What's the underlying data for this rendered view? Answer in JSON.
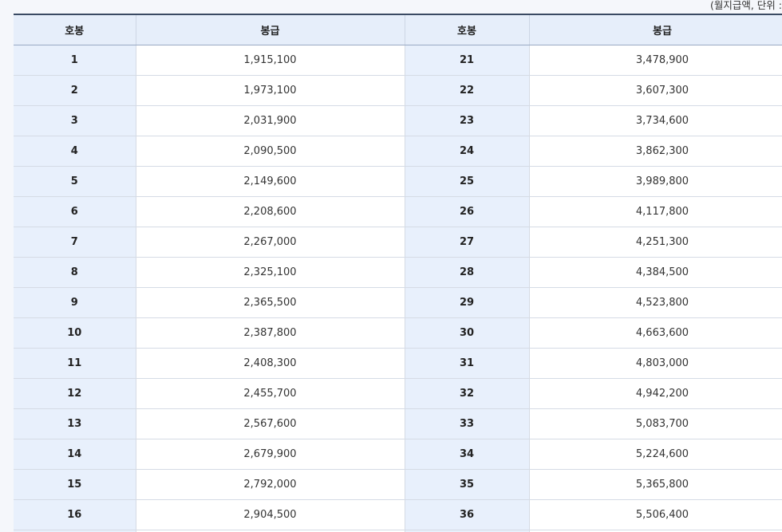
{
  "unit_note": "(월지급액, 단위 :",
  "headers": {
    "step_left": "호봉",
    "pay_left": "봉급",
    "step_right": "호봉",
    "pay_right": "봉급"
  },
  "rows": [
    {
      "step_left": "1",
      "pay_left": "1,915,100",
      "step_right": "21",
      "pay_right": "3,478,900"
    },
    {
      "step_left": "2",
      "pay_left": "1,973,100",
      "step_right": "22",
      "pay_right": "3,607,300"
    },
    {
      "step_left": "3",
      "pay_left": "2,031,900",
      "step_right": "23",
      "pay_right": "3,734,600"
    },
    {
      "step_left": "4",
      "pay_left": "2,090,500",
      "step_right": "24",
      "pay_right": "3,862,300"
    },
    {
      "step_left": "5",
      "pay_left": "2,149,600",
      "step_right": "25",
      "pay_right": "3,989,800"
    },
    {
      "step_left": "6",
      "pay_left": "2,208,600",
      "step_right": "26",
      "pay_right": "4,117,800"
    },
    {
      "step_left": "7",
      "pay_left": "2,267,000",
      "step_right": "27",
      "pay_right": "4,251,300"
    },
    {
      "step_left": "8",
      "pay_left": "2,325,100",
      "step_right": "28",
      "pay_right": "4,384,500"
    },
    {
      "step_left": "9",
      "pay_left": "2,365,500",
      "step_right": "29",
      "pay_right": "4,523,800"
    },
    {
      "step_left": "10",
      "pay_left": "2,387,800",
      "step_right": "30",
      "pay_right": "4,663,600"
    },
    {
      "step_left": "11",
      "pay_left": "2,408,300",
      "step_right": "31",
      "pay_right": "4,803,000"
    },
    {
      "step_left": "12",
      "pay_left": "2,455,700",
      "step_right": "32",
      "pay_right": "4,942,200"
    },
    {
      "step_left": "13",
      "pay_left": "2,567,600",
      "step_right": "33",
      "pay_right": "5,083,700"
    },
    {
      "step_left": "14",
      "pay_left": "2,679,900",
      "step_right": "34",
      "pay_right": "5,224,600"
    },
    {
      "step_left": "15",
      "pay_left": "2,792,000",
      "step_right": "35",
      "pay_right": "5,365,800"
    },
    {
      "step_left": "16",
      "pay_left": "2,904,500",
      "step_right": "36",
      "pay_right": "5,506,400"
    }
  ],
  "colors": {
    "header_bg": "#e6eefa",
    "step_cell_bg": "#e8f0fc",
    "top_border": "#3a4a63"
  }
}
